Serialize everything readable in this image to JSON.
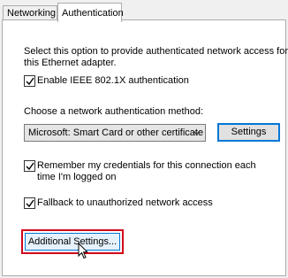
{
  "tabs": [
    {
      "label": "Networking"
    },
    {
      "label": "Authentication"
    }
  ],
  "auth": {
    "description_line1": "Select this option to provide authenticated network access for",
    "description_line2": "this Ethernet adapter.",
    "enable_8021x_label": "Enable IEEE 802.1X authentication",
    "enable_8021x_checked": true,
    "method_prompt": "Choose a network authentication method:",
    "method_selected": "Microsoft: Smart Card or other certificate",
    "settings_button": "Settings",
    "remember_line1": "Remember my credentials for this connection each",
    "remember_line2": "time I'm logged on",
    "remember_checked": true,
    "fallback_label": "Fallback to unauthorized network access",
    "fallback_checked": true,
    "additional_settings_button": "Additional Settings..."
  },
  "colors": {
    "highlight": "#d0021b",
    "focus_blue": "#0078d7"
  }
}
